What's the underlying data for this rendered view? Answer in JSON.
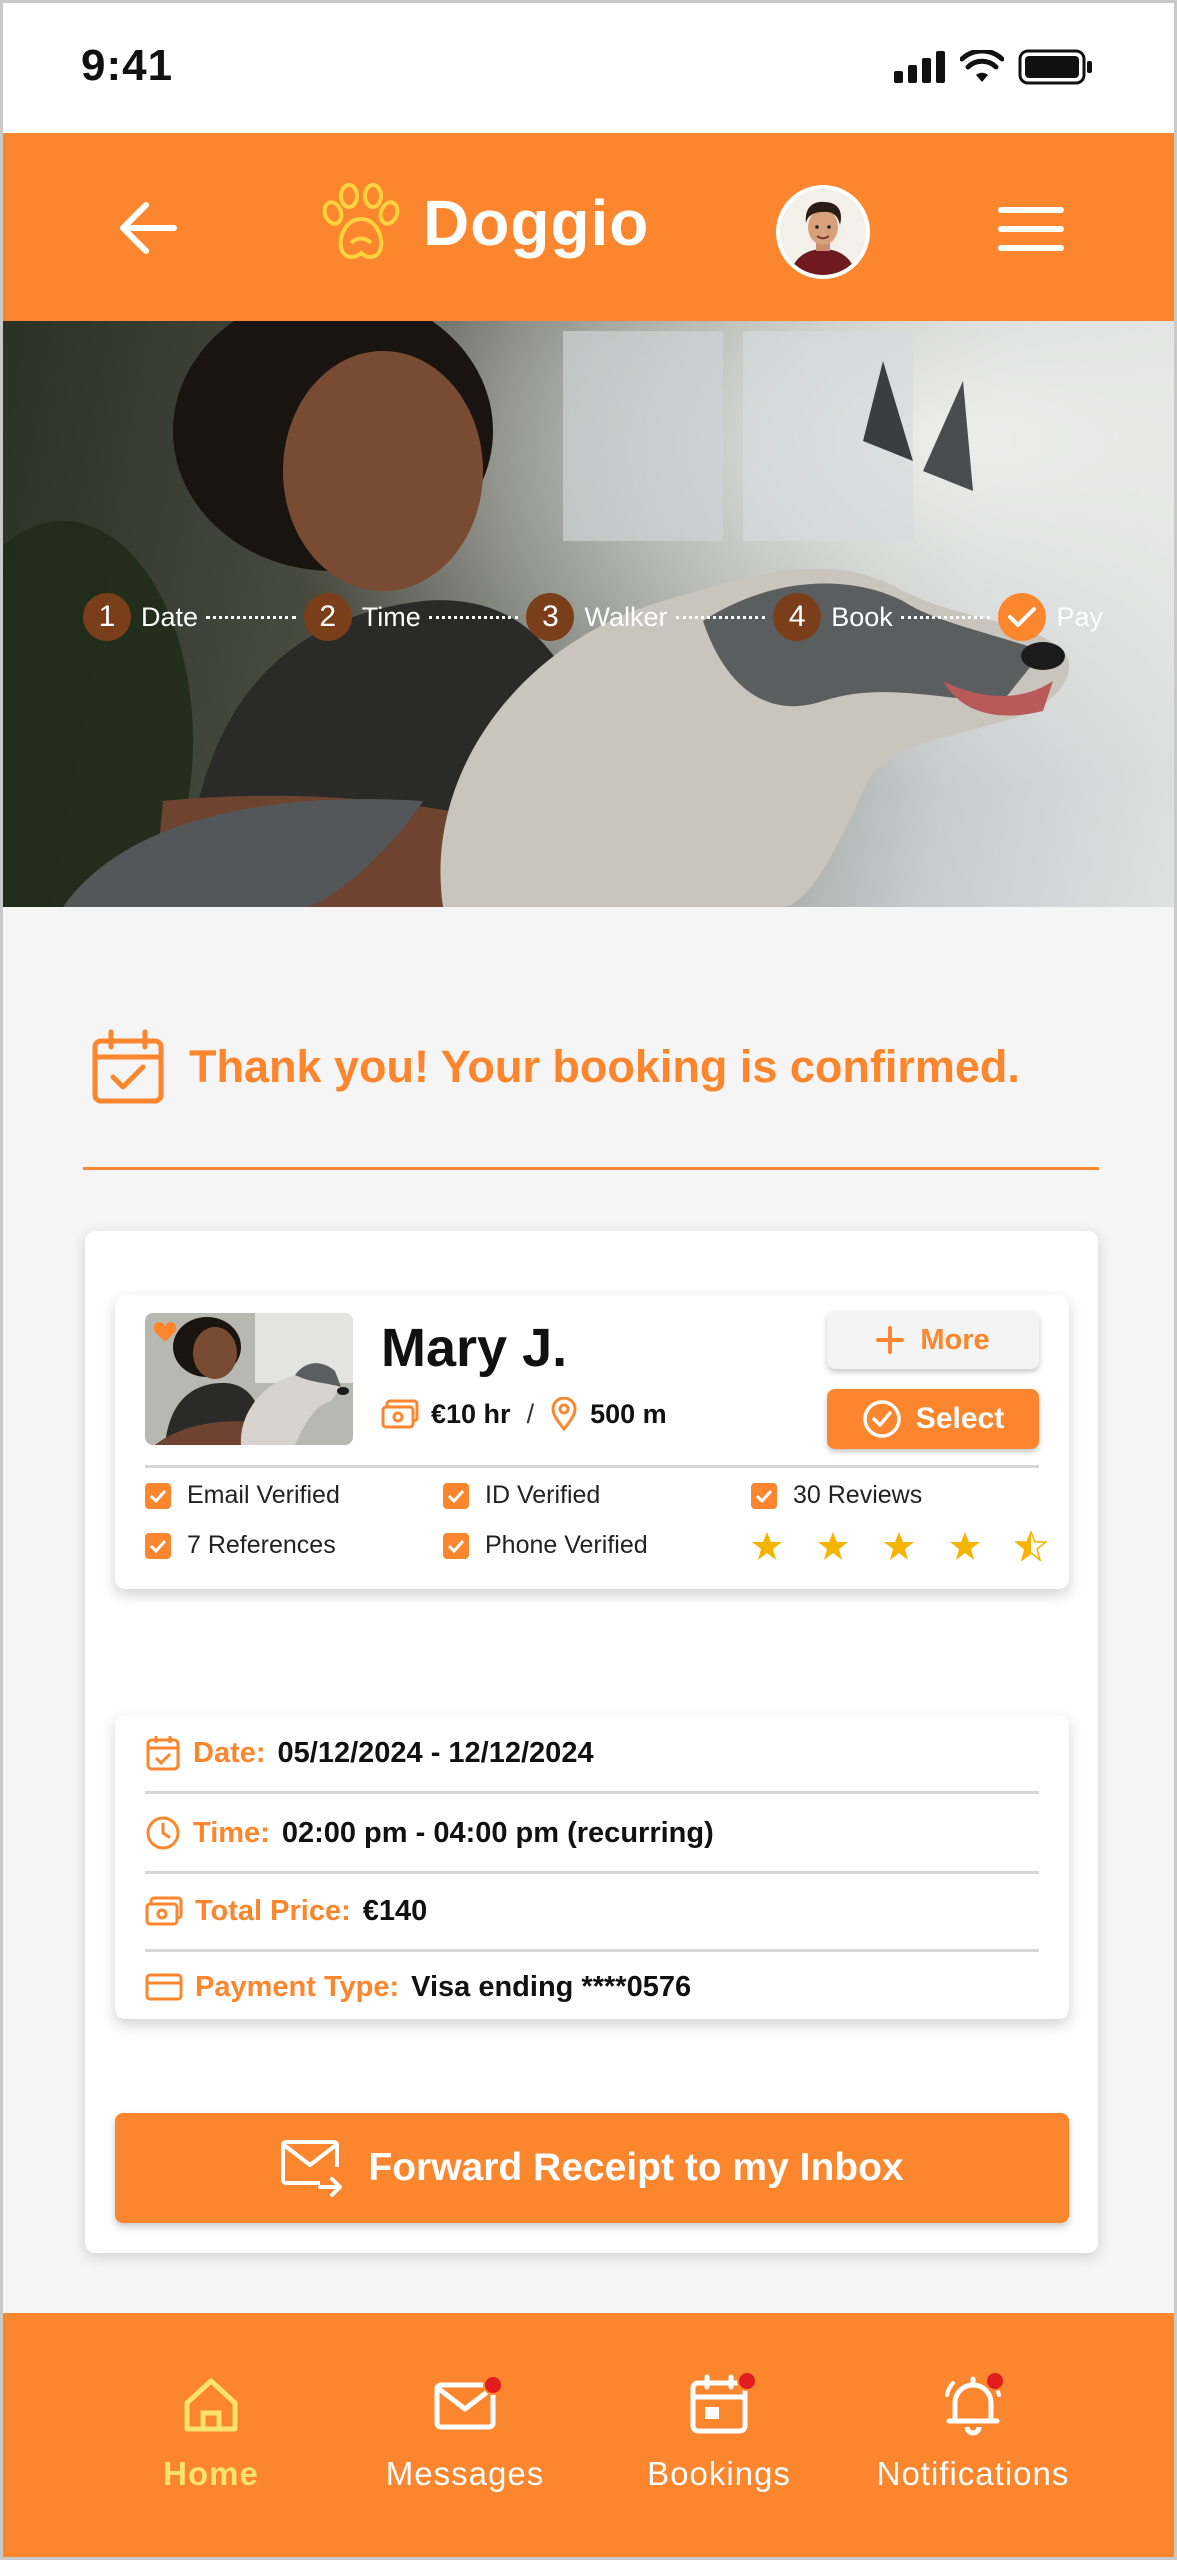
{
  "status_bar": {
    "time": "9:41"
  },
  "header": {
    "brand": "Doggio"
  },
  "steps": [
    {
      "num": "1",
      "label": "Date"
    },
    {
      "num": "2",
      "label": "Time"
    },
    {
      "num": "3",
      "label": "Walker"
    },
    {
      "num": "4",
      "label": "Book"
    },
    {
      "num": "",
      "label": "Pay",
      "done": true
    }
  ],
  "confirmation": {
    "text": "Thank you! Your booking is confirmed."
  },
  "walker": {
    "name": "Mary J.",
    "rate": "€10 hr",
    "separator": "/",
    "distance": "500 m",
    "more_label": "More",
    "select_label": "Select",
    "checks": {
      "email": "Email Verified",
      "id": "ID Verified",
      "reviews": "30 Reviews",
      "references": "7 References",
      "phone": "Phone Verified"
    },
    "rating": 4.5
  },
  "details": {
    "date_key": "Date:",
    "date_val": "05/12/2024 - 12/12/2024",
    "time_key": "Time:",
    "time_val": "02:00 pm - 04:00 pm (recurring)",
    "price_key": "Total Price:",
    "price_val": "€140",
    "payment_key": "Payment Type:",
    "payment_val": "Visa ending ****0576"
  },
  "forward_button": "Forward Receipt to my Inbox",
  "nav": {
    "home": "Home",
    "messages": "Messages",
    "bookings": "Bookings",
    "notifications": "Notifications"
  },
  "colors": {
    "accent": "#fc862d",
    "nav_active": "#ffe36a",
    "badge": "#e01c1c",
    "star": "#f5b400"
  }
}
